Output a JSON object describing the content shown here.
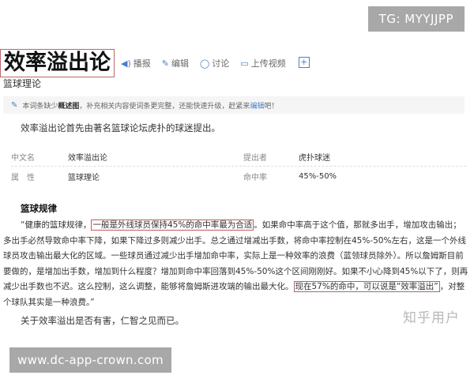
{
  "tg_badge": "TG: MYYJJPP",
  "url_badge": "www.dc-app-crown.com",
  "entry": {
    "title": "效率溢出论",
    "subtitle": "篮球理论",
    "actions": [
      {
        "icon": "speaker-icon",
        "label": "播报"
      },
      {
        "icon": "pencil-icon",
        "label": "编辑"
      },
      {
        "icon": "chat-icon",
        "label": "讨论"
      },
      {
        "icon": "video-icon",
        "label": "上传视频"
      }
    ]
  },
  "notice": {
    "part1": "本词条缺少",
    "bold": "概述图",
    "part2": "，补充相关内容使词条更完整，还能快速升级，赶紧来",
    "link": "编辑",
    "part3": "吧！"
  },
  "intro": "效率溢出论首先由著名篮球论坛虎扑的球迷提出。",
  "infobox": {
    "rows": [
      {
        "label1": "中文名",
        "value1": "效率溢出论",
        "label2": "提出者",
        "value2": "虎扑球迷"
      },
      {
        "label1": "属　性",
        "value1": "篮球理论",
        "label2": "命中率",
        "value2": "45%-50%"
      }
    ]
  },
  "section_title": "篮球规律",
  "paragraph": {
    "t1": "“健康的篮球规律，",
    "h1": "一般是外线球员保持45%的命中率最为合适",
    "t2": "。如果命中率高于这个值，那就多出手，增加攻击输出；多出手必然导致命中率下降，如果下降过多则减少出手。总之通过增减出手数，将命中率控制在45%-50%左右，这是一个外线球员攻击输出最大化的区域。一些球员通过减少出手增加命中率，实际上是一种效率的浪费（蓝领球员除外）。所以詹姆斯目前要做的，是增加出手数，增加到什么程度？增加到命中率回落到45%-50%这个区间刚刚好。如果不小心降到45%以下了，则再减少出手数也不迟。这么控制，这么调整，能够将詹姆斯进攻端的输出最大化。",
    "h2": "现在57%的命中，可以说是“效率溢出”",
    "t3": "，对整个球队其实是一种浪费。”"
  },
  "watermark": "知乎用户",
  "conclusion": "关于效率溢出是否有害，仁智之见而已。"
}
